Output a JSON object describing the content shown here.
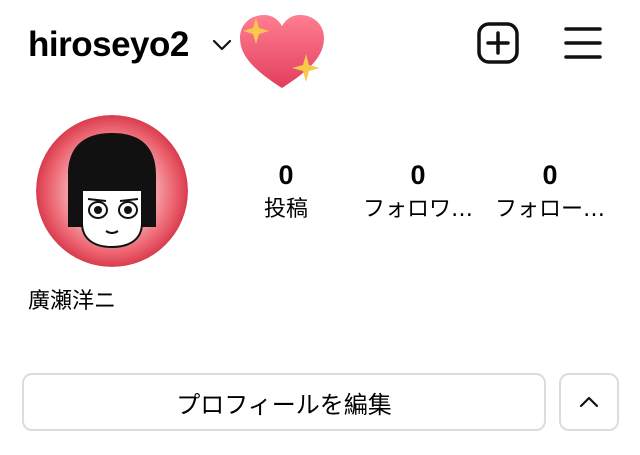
{
  "header": {
    "username": "hiroseyo2",
    "account_switch_icon": "chevron-down-icon",
    "emoji_icon": "sparkling-heart-icon",
    "new_post_icon": "plus-square-icon",
    "menu_icon": "hamburger-menu-icon"
  },
  "profile": {
    "avatar_icon": "avatar",
    "display_name": "廣瀬洋ニ"
  },
  "stats": [
    {
      "value": "0",
      "label": "投稿"
    },
    {
      "value": "0",
      "label": "フォロワ…"
    },
    {
      "value": "0",
      "label": "フォロー…"
    }
  ],
  "actions": {
    "edit_profile_label": "プロフィールを編集",
    "suggestions_toggle_icon": "chevron-up-icon"
  },
  "colors": {
    "heart": "#e8506a",
    "sparkle": "#f7c94a",
    "avatar_ring": "#e64a5a",
    "button_border": "#dcdcdc"
  }
}
